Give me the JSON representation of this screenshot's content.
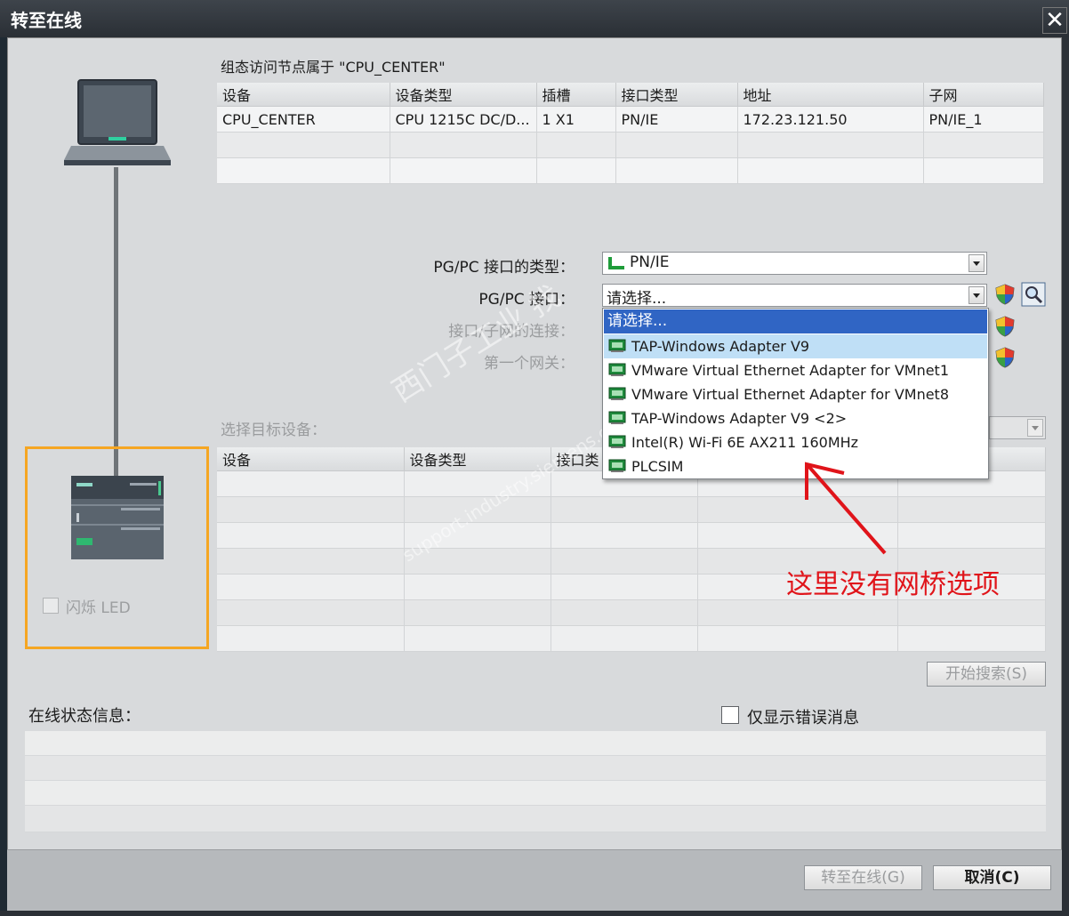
{
  "window": {
    "title": "转至在线",
    "close_glyph": "✕"
  },
  "access_node_label": "组态访问节点属于 \"CPU_CENTER\"",
  "access_table": {
    "headers": [
      "设备",
      "设备类型",
      "插槽",
      "接口类型",
      "地址",
      "子网"
    ],
    "rows": [
      [
        "CPU_CENTER",
        "CPU 1215C DC/D...",
        "1 X1",
        "PN/IE",
        "172.23.121.50",
        "PN/IE_1"
      ]
    ]
  },
  "form": {
    "interface_type_label": "PG/PC 接口的类型：",
    "interface_type_value": "PN/IE",
    "interface_label": "PG/PC 接口：",
    "interface_value": "请选择...",
    "subnet_conn_label": "接口/子网的连接：",
    "first_gateway_label": "第一个网关："
  },
  "dropdown": {
    "items": [
      "请选择...",
      "TAP-Windows Adapter V9",
      "VMware Virtual Ethernet Adapter for VMnet1",
      "VMware Virtual Ethernet Adapter for VMnet8",
      "TAP-Windows Adapter V9 <2>",
      "Intel(R) Wi-Fi 6E AX211 160MHz",
      "PLCSIM"
    ]
  },
  "target": {
    "label": "选择目标设备：",
    "headers": [
      "设备",
      "设备类型",
      "接口类"
    ]
  },
  "watermark": {
    "line1": "西门子工业  找",
    "line2": "support.industry.siemens.com"
  },
  "device": {
    "flash_led_label": "闪烁 LED"
  },
  "annotation": {
    "text": "这里没有网桥选项",
    "color": "#e0141a"
  },
  "buttons": {
    "start_search": "开始搜索(S)",
    "go_online": "转至在线(G)",
    "cancel": "取消(C)"
  },
  "status": {
    "label": "在线状态信息：",
    "only_errors_label": "仅显示错误消息"
  },
  "colors": {
    "selection_blue": "#3065c4",
    "hover_blue": "#bfdff6",
    "highlight_orange": "#f5a623"
  },
  "icons": {
    "interface_type": "network-plug-icon",
    "nic": "network-card-icon",
    "shield": "security-shield-icon",
    "properties": "magnifier-properties-icon"
  }
}
